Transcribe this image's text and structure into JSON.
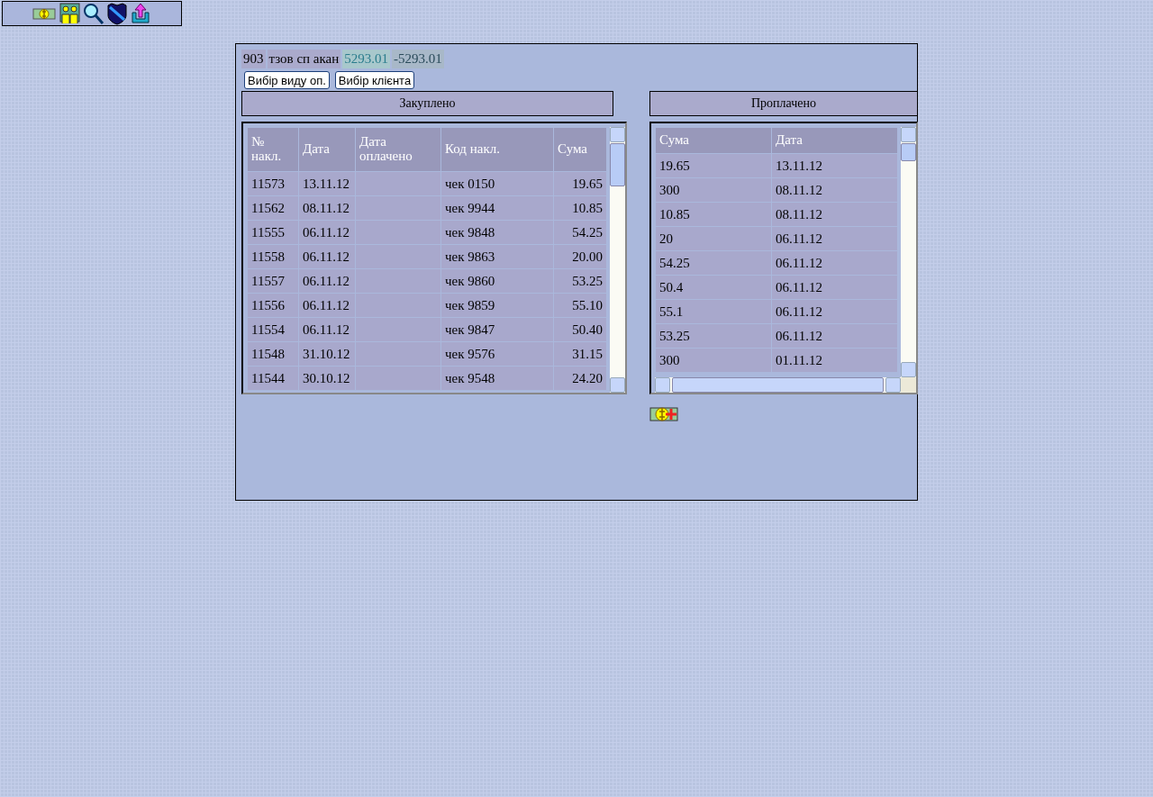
{
  "toolbar": {
    "icons": [
      {
        "kind": "money"
      },
      {
        "kind": "people"
      },
      {
        "kind": "search"
      },
      {
        "kind": "shield"
      },
      {
        "kind": "upload"
      }
    ]
  },
  "info": {
    "code": "903",
    "client": "тзов сп акан",
    "amount": "5293.01",
    "balance": "-5293.01"
  },
  "buttons": [
    "Вибір виду оп.",
    "Вибір клієнта"
  ],
  "purchased": {
    "title": "Закуплено",
    "columns": [
      "№ накл.",
      "Дата",
      "Дата оплачено",
      "Код накл.",
      "Сума"
    ],
    "rows": [
      [
        "11573",
        "13.11.12",
        "",
        "чек 0150",
        "19.65"
      ],
      [
        "11562",
        "08.11.12",
        "",
        "чек 9944",
        "10.85"
      ],
      [
        "11555",
        "06.11.12",
        "",
        "чек 9848",
        "54.25"
      ],
      [
        "11558",
        "06.11.12",
        "",
        "чек 9863",
        "20.00"
      ],
      [
        "11557",
        "06.11.12",
        "",
        "чек 9860",
        "53.25"
      ],
      [
        "11556",
        "06.11.12",
        "",
        "чек 9859",
        "55.10"
      ],
      [
        "11554",
        "06.11.12",
        "",
        "чек 9847",
        "50.40"
      ],
      [
        "11548",
        "31.10.12",
        "",
        "чек 9576",
        "31.15"
      ],
      [
        "11544",
        "30.10.12",
        "",
        "чек 9548",
        "24.20"
      ]
    ]
  },
  "paid": {
    "title": "Проплачено",
    "columns": [
      "Сума",
      "Дата"
    ],
    "rows": [
      [
        "19.65",
        "13.11.12"
      ],
      [
        "300",
        "08.11.12"
      ],
      [
        "10.85",
        "08.11.12"
      ],
      [
        "20",
        "06.11.12"
      ],
      [
        "54.25",
        "06.11.12"
      ],
      [
        "50.4",
        "06.11.12"
      ],
      [
        "55.1",
        "06.11.12"
      ],
      [
        "53.25",
        "06.11.12"
      ],
      [
        "300",
        "01.11.12"
      ]
    ]
  }
}
